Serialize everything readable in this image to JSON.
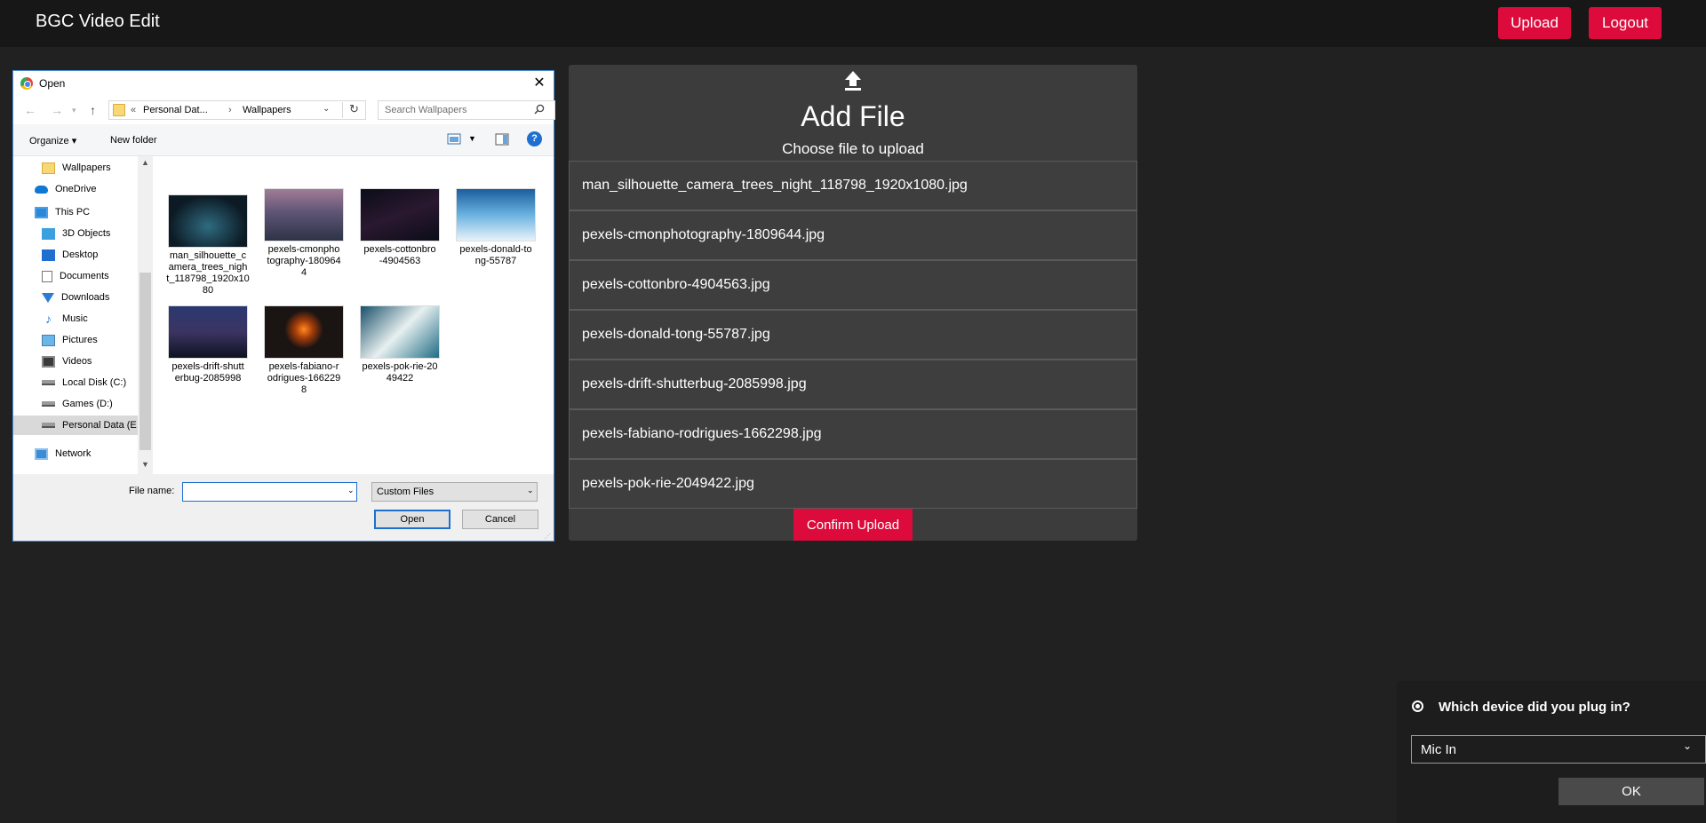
{
  "app": {
    "title": "BGC Video Edit",
    "upload_label": "Upload",
    "logout_label": "Logout",
    "accent_color": "#dc0b3b"
  },
  "upload_panel": {
    "icon": "upload-icon",
    "title": "Add File",
    "subtitle": "Choose file to upload",
    "files": [
      "man_silhouette_camera_trees_night_118798_1920x1080.jpg",
      "pexels-cmonphotography-1809644.jpg",
      "pexels-cottonbro-4904563.jpg",
      "pexels-donald-tong-55787.jpg",
      "pexels-drift-shutterbug-2085998.jpg",
      "pexels-fabiano-rodrigues-1662298.jpg",
      "pexels-pok-rie-2049422.jpg"
    ],
    "confirm_label": "Confirm Upload"
  },
  "file_dialog": {
    "title": "Open",
    "address": {
      "chevron": "«",
      "crumb1": "Personal Dat...",
      "separator": "›",
      "crumb2": "Wallpapers"
    },
    "search_placeholder": "Search Wallpapers",
    "toolbar": {
      "organize": "Organize ▾",
      "new_folder": "New folder",
      "help": "?"
    },
    "nav_items": [
      {
        "label": "Wallpapers",
        "icon": "folder-icon"
      },
      {
        "label": "OneDrive",
        "icon": "cloud-icon"
      },
      {
        "label": "This PC",
        "icon": "computer-icon"
      },
      {
        "label": "3D Objects",
        "icon": "cube-icon"
      },
      {
        "label": "Desktop",
        "icon": "desktop-icon"
      },
      {
        "label": "Documents",
        "icon": "document-icon"
      },
      {
        "label": "Downloads",
        "icon": "download-icon"
      },
      {
        "label": "Music",
        "icon": "music-icon"
      },
      {
        "label": "Pictures",
        "icon": "pictures-icon"
      },
      {
        "label": "Videos",
        "icon": "videos-icon"
      },
      {
        "label": "Local Disk (C:)",
        "icon": "disk-icon"
      },
      {
        "label": "Games (D:)",
        "icon": "disk-icon"
      },
      {
        "label": "Personal Data (E",
        "icon": "disk-icon"
      },
      {
        "label": "Network",
        "icon": "network-icon"
      }
    ],
    "thumbnails": [
      [
        "man_silhouette_c",
        "amera_trees_nigh",
        "t_118798_1920x10",
        "80"
      ],
      [
        "pexels-cmonpho",
        "tography-180964",
        "4"
      ],
      [
        "pexels-cottonbro",
        "-4904563"
      ],
      [
        "pexels-donald-to",
        "ng-55787"
      ],
      [
        "pexels-drift-shutt",
        "erbug-2085998"
      ],
      [
        "pexels-fabiano-r",
        "odrigues-166229",
        "8"
      ],
      [
        "pexels-pok-rie-20",
        "49422"
      ]
    ],
    "file_name_label": "File name:",
    "file_name_value": "",
    "file_type_value": "Custom Files",
    "open_label": "Open",
    "cancel_label": "Cancel"
  },
  "notification": {
    "title": "Which device did you plug in?",
    "selected": "Mic In",
    "ok_label": "OK"
  }
}
